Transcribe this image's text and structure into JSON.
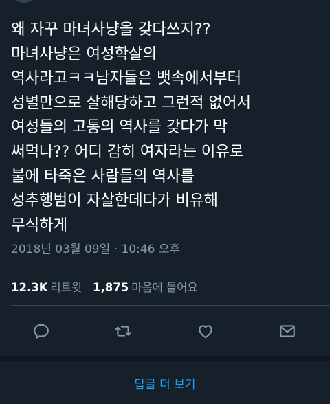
{
  "tweet": {
    "lines": [
      "왜 자꾸 마녀사냥을 갖다쓰지??",
      "마녀사냥은 여성학살의",
      "역사라고ㅋㅋ남자들은 뱃속에서부터",
      "성별만으로 살해당하고 그런적 없어서",
      "여성들의 고통의 역사를 갖다가 막",
      "써먹나?? 어디 감히 여자라는 이유로",
      "불에 타죽은 사람들의 역사를",
      "성추행범이 자살한데다가 비유해",
      "무식하게"
    ],
    "timestamp": "2018년 03월 09일 · 10:46 오후"
  },
  "stats": {
    "retweets_count": "12.3K",
    "retweets_label": "리트윗",
    "likes_count": "1,875",
    "likes_label": "마음에 들어요"
  },
  "actions": {
    "icons": [
      "reply-icon",
      "retweet-icon",
      "like-icon",
      "dm-icon"
    ]
  },
  "footer": {
    "more_replies_label": "답글 더 보기"
  },
  "colors": {
    "background": "#15202b",
    "text_primary": "#ffffff",
    "text_secondary": "#8899a6",
    "accent": "#1da1f2",
    "divider": "#38444d"
  }
}
